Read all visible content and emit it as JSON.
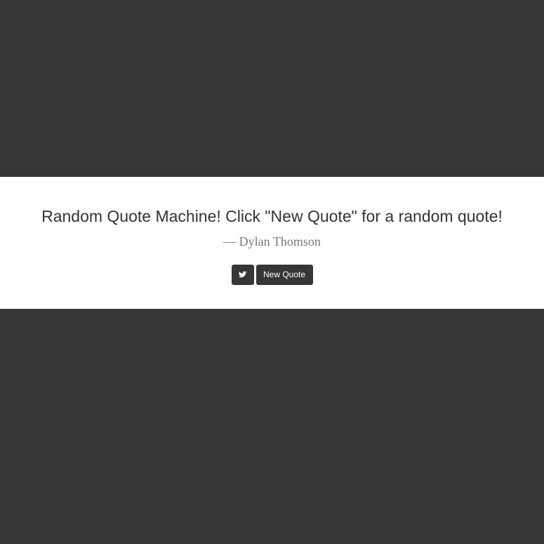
{
  "quote": {
    "text": "Random Quote Machine! Click \"New Quote\" for a random quote!",
    "author": "— Dylan Thomson"
  },
  "buttons": {
    "tweet_icon": "twitter-icon",
    "new_quote_label": "New Quote"
  },
  "colors": {
    "background": "#363636",
    "panel": "#ffffff",
    "button": "#363636",
    "quote_text": "#333333",
    "author_text": "#777777"
  }
}
